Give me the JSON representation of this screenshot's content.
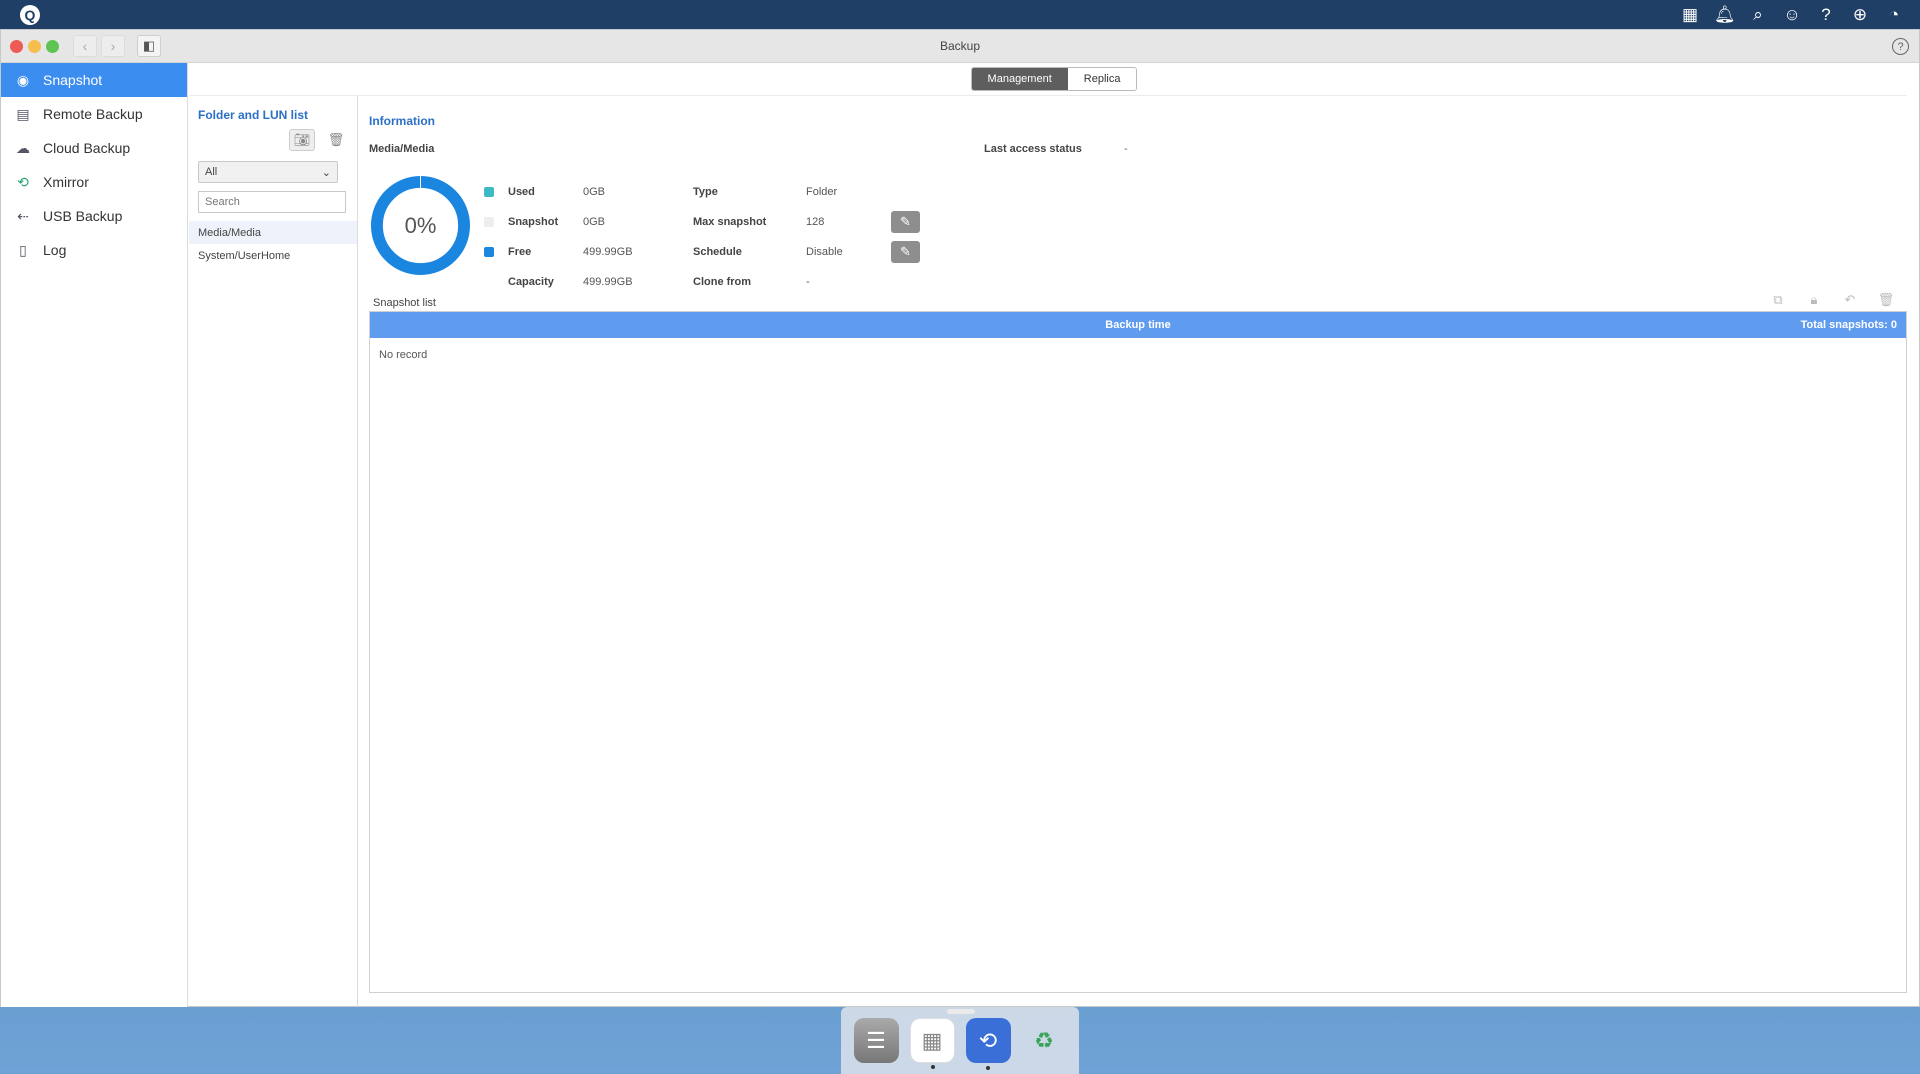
{
  "system": {
    "icons": [
      "grid-icon",
      "bell-icon",
      "search-icon",
      "user-icon",
      "help-icon",
      "globe-icon",
      "dashboard-icon"
    ]
  },
  "window": {
    "title": "Backup"
  },
  "nav": {
    "items": [
      {
        "label": "Snapshot",
        "icon": "camera-icon"
      },
      {
        "label": "Remote Backup",
        "icon": "server-icon"
      },
      {
        "label": "Cloud Backup",
        "icon": "cloud-icon"
      },
      {
        "label": "Xmirror",
        "icon": "sync-icon"
      },
      {
        "label": "USB Backup",
        "icon": "usb-icon"
      },
      {
        "label": "Log",
        "icon": "document-icon"
      }
    ]
  },
  "tabs": {
    "management": "Management",
    "replica": "Replica"
  },
  "folders": {
    "title": "Folder and LUN list",
    "filter_value": "All",
    "search_placeholder": "Search",
    "items": [
      "Media/Media",
      "System/UserHome"
    ]
  },
  "info": {
    "title": "Information",
    "folder": "Media/Media",
    "last_access_label": "Last access status",
    "last_access_value": "-",
    "usage_percent": 0,
    "usage_text": "0%",
    "legend": [
      {
        "label": "Used",
        "value": "0GB",
        "color": "#3cb8c6"
      },
      {
        "label": "Snapshot",
        "value": "0GB",
        "color": "#eeeeee"
      },
      {
        "label": "Free",
        "value": "499.99GB",
        "color": "#1a86e0"
      },
      {
        "label": "Capacity",
        "value": "499.99GB",
        "color": ""
      }
    ],
    "props": [
      {
        "label": "Type",
        "value": "Folder"
      },
      {
        "label": "Max snapshot",
        "value": "128"
      },
      {
        "label": "Schedule",
        "value": "Disable"
      },
      {
        "label": "Clone from",
        "value": "-"
      }
    ]
  },
  "snapshots": {
    "title": "Snapshot list",
    "column_time": "Backup time",
    "total": "Total snapshots: 0",
    "empty": "No record"
  },
  "colors": {
    "accent": "#3c8df0",
    "donut_free": "#1a86e0",
    "header": "#5f9cf0"
  }
}
